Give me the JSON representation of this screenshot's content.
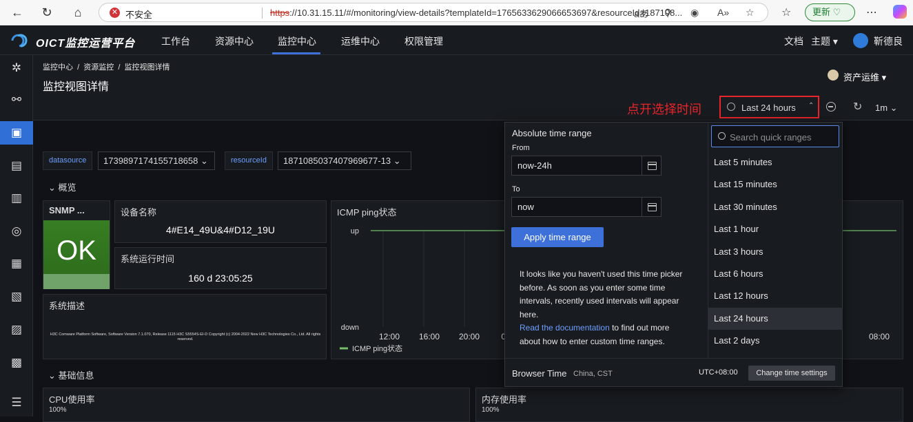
{
  "browser": {
    "security_label": "不安全",
    "url_proto": "https",
    "url_rest": "://10.31.15.11/#/monitoring/view-details?templateId=1765633629066653697&resourceId=187108...",
    "update_label": "更新"
  },
  "header": {
    "logo_text": "OICT监控运营平台",
    "nav": [
      "工作台",
      "资源中心",
      "监控中心",
      "运维中心",
      "权限管理"
    ],
    "active_nav": "监控中心",
    "docs": "文档",
    "theme": "主题",
    "user": "靳德良"
  },
  "page": {
    "breadcrumb": [
      "监控中心",
      "资源监控",
      "监控视图详情"
    ],
    "title": "监控视图详情",
    "role": "资产运维"
  },
  "annotation": "点开选择时间",
  "toolbar": {
    "time_range": "Last 24 hours",
    "interval": "1m"
  },
  "variables": [
    {
      "label": "datasource",
      "value": "1739897174155718658"
    },
    {
      "label": "resourceId",
      "value": "1871085037407969677-13"
    }
  ],
  "rows": [
    "概览",
    "基础信息"
  ],
  "panels": {
    "snmp": {
      "title": "SNMP ...",
      "status": "OK"
    },
    "device_name": {
      "title": "设备名称",
      "value": "4#E14_49U&4#D12_19U"
    },
    "uptime": {
      "title": "系统运行时间",
      "value": "160 d 23:05:25"
    },
    "sysdesc": {
      "title": "系统描述",
      "value": "H3C Comware Platform Software, Software Version 7.1.070, Release 1115 H3C S5554S-EI-D Copyright (c) 2004-2022 New H3C Technologies Co., Ltd. All rights reserved."
    },
    "cpu": {
      "title": "CPU使用率",
      "partial_value": "100%"
    },
    "mem": {
      "title": "内存使用率",
      "partial_value": "100%"
    }
  },
  "chart_data": {
    "type": "line",
    "title": "ICMP ping状态",
    "y_categories": [
      "down",
      "up"
    ],
    "x_ticks_visible": [
      "12:00",
      "16:00",
      "20:00",
      "00",
      "08:00"
    ],
    "series": [
      {
        "name": "ICMP ping状态",
        "color": "#73bf69",
        "value": "up"
      }
    ]
  },
  "time_picker": {
    "absolute_title": "Absolute time range",
    "from_label": "From",
    "from_value": "now-24h",
    "to_label": "To",
    "to_value": "now",
    "apply_label": "Apply time range",
    "hint_text": "It looks like you haven't used this time picker before. As soon as you enter some time intervals, recently used intervals will appear here.",
    "hint_link": "Read the documentation",
    "hint_tail": " to find out more about how to enter custom time ranges.",
    "search_placeholder": "Search quick ranges",
    "quick_ranges": [
      "Last 5 minutes",
      "Last 15 minutes",
      "Last 30 minutes",
      "Last 1 hour",
      "Last 3 hours",
      "Last 6 hours",
      "Last 12 hours",
      "Last 24 hours",
      "Last 2 days"
    ],
    "selected_range": "Last 24 hours",
    "browser_time_label": "Browser Time",
    "browser_zone": "China, CST",
    "utc_offset": "UTC+08:00",
    "change_label": "Change time settings"
  },
  "colors": {
    "accent": "#3d71d9",
    "ok_green": "#377d22",
    "annotation_red": "#e8252b",
    "bg": "#111217",
    "panel": "#181b1f"
  }
}
